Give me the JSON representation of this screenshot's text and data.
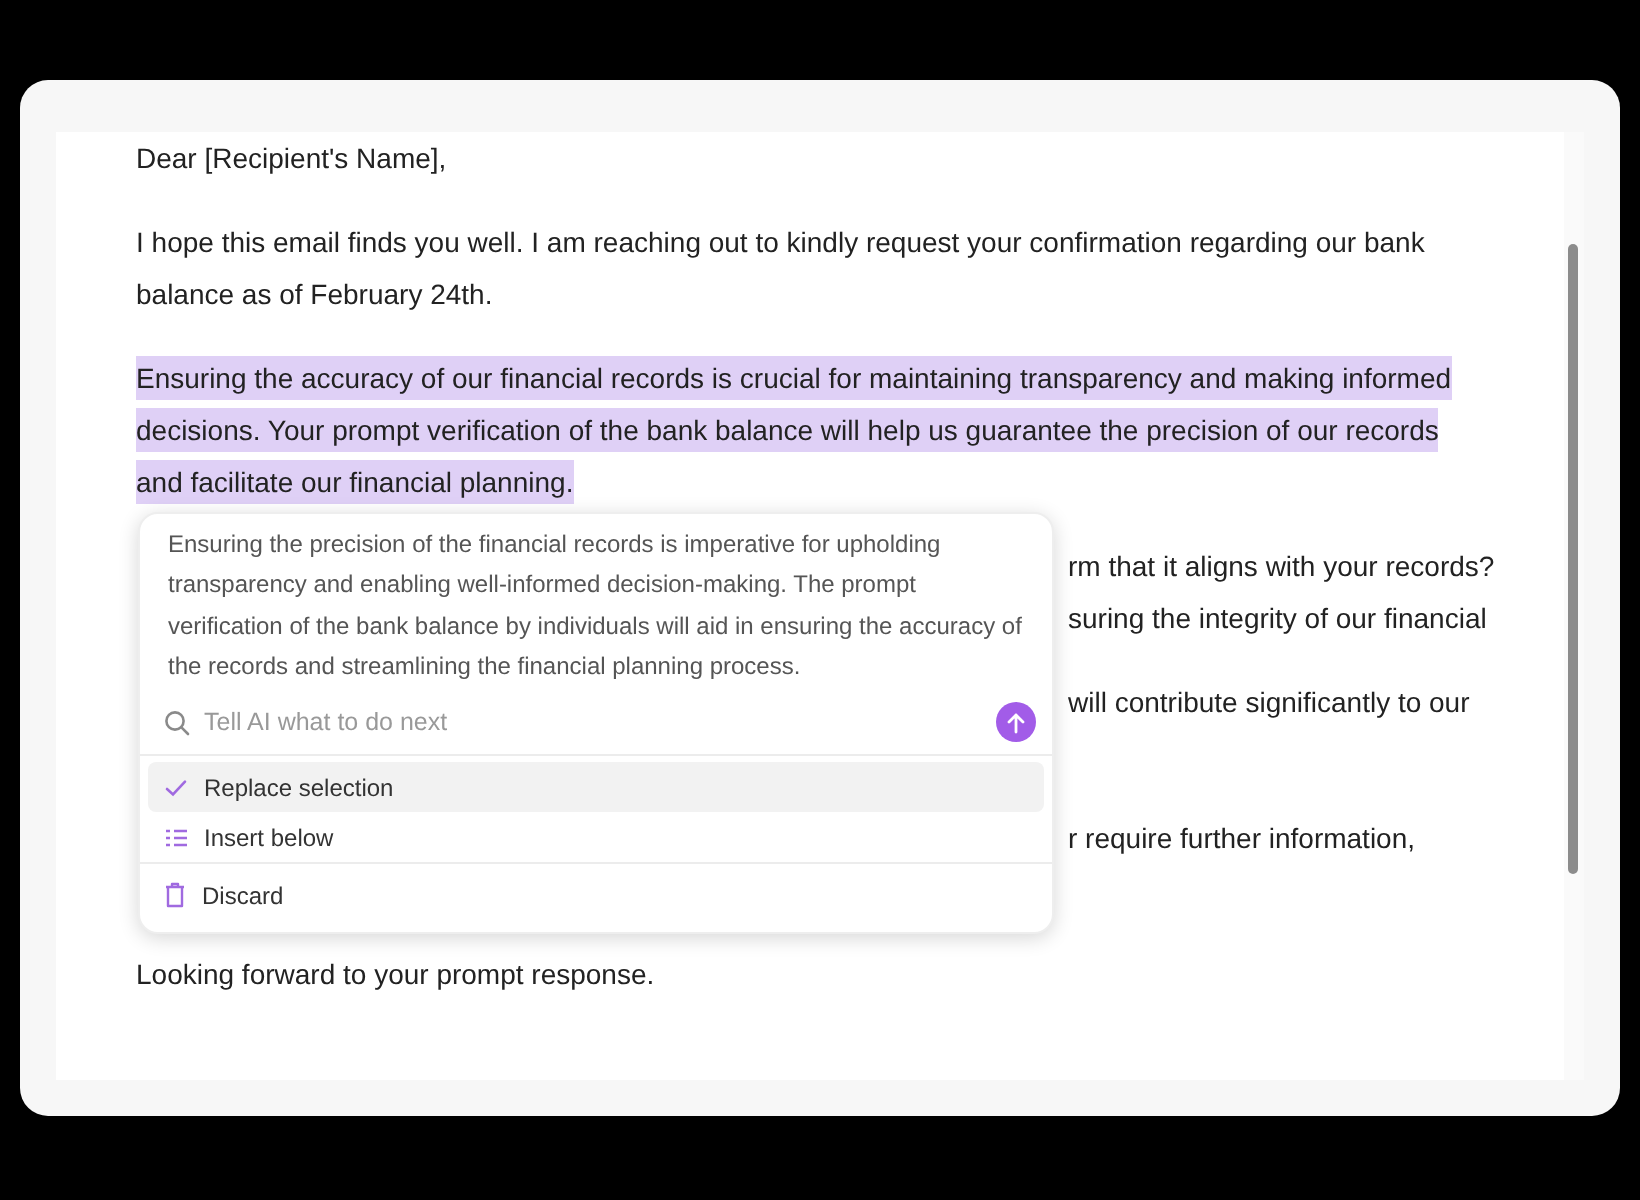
{
  "paragraphs": [
    {
      "kind": "full",
      "selected": false,
      "lines": [
        "Dear [Recipient's Name],"
      ]
    },
    {
      "kind": "full",
      "selected": false,
      "lines": [
        "I hope this email finds you well. I am reaching out to kindly request your confirmation regarding our bank",
        "balance as of February 24th."
      ]
    },
    {
      "kind": "full",
      "selected": true,
      "lines": [
        "Ensuring the accuracy of our financial records is crucial for maintaining transparency and making informed",
        "decisions. Your prompt verification of the bank balance will help us guarantee the precision of our records",
        "and facilitate our financial planning."
      ]
    },
    {
      "kind": "covered",
      "selected": false,
      "lines": [
        "rm that it aligns with your records?",
        "suring the integrity of our financial"
      ]
    },
    {
      "kind": "covered",
      "selected": false,
      "lines": [
        "will contribute significantly to our"
      ]
    },
    {
      "kind": "covered",
      "selected": false,
      "lines": [
        "r require further information,"
      ]
    },
    {
      "kind": "full",
      "selected": false,
      "lines": [
        "Looking forward to your prompt response."
      ]
    }
  ],
  "ai_popup": {
    "suggestion": "Ensuring the precision of the financial records is imperative for upholding transparency and enabling well-informed decision-making. The prompt verification of the bank balance by individuals will aid in ensuring the accuracy of the records and streamlining the financial planning process.",
    "prompt": {
      "placeholder": "Tell AI what to do next"
    },
    "actions": [
      {
        "kind": "check",
        "label": "Replace selection",
        "selected": true
      },
      {
        "kind": "list",
        "label": "Insert below",
        "selected": false
      },
      {
        "kind": "trash",
        "label": "Discard",
        "selected": false
      }
    ]
  }
}
